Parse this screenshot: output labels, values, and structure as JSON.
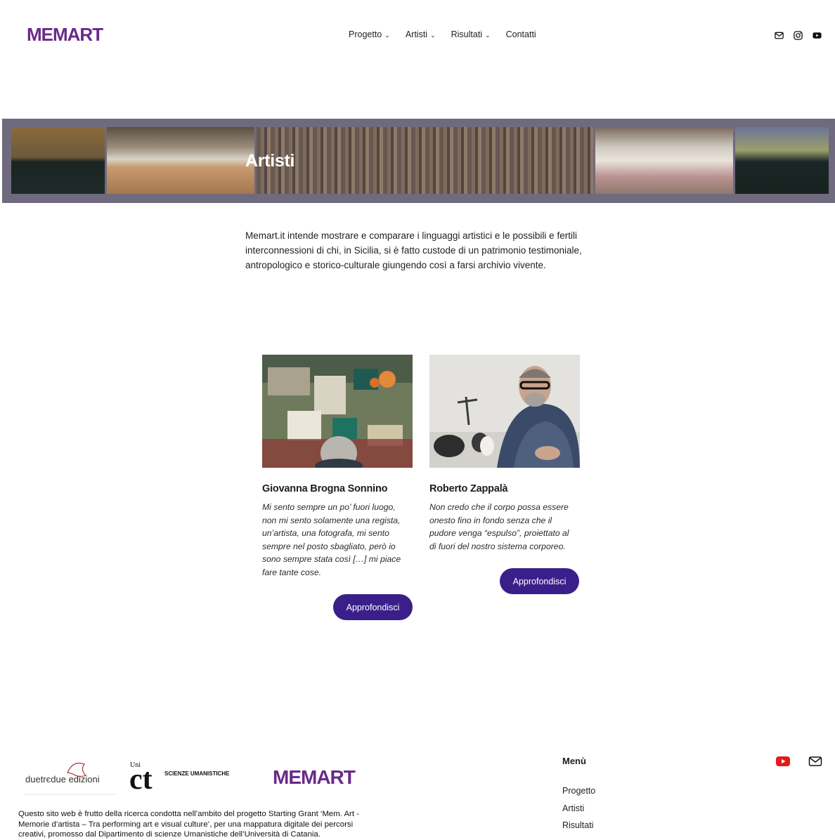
{
  "header": {
    "logo_text": "MEMART",
    "nav": [
      {
        "label": "Progetto",
        "has_dropdown": true
      },
      {
        "label": "Artisti",
        "has_dropdown": true
      },
      {
        "label": "Risultati",
        "has_dropdown": true
      },
      {
        "label": "Contatti",
        "has_dropdown": false
      }
    ],
    "social_icons": [
      "mail-icon",
      "instagram-icon",
      "youtube-icon"
    ]
  },
  "hero": {
    "title": "Artisti"
  },
  "intro": "Memart.it intende mostrare e comparare i linguaggi artistici e le possibili e fertili interconnessioni di chi, in Sicilia, si è fatto custode di un patrimonio testimoniale, antropologico e storico-culturale giungendo così a farsi archivio vivente.",
  "artists": [
    {
      "name": "Giovanna Brogna Sonnino",
      "quote": "Mi sento sempre un po’ fuori luogo, non mi sento solamente una regista, un’artista, una fotografa, mi sento sempre nel posto sbagliato, però io sono sempre stata così […] mi piace fare tante cose.",
      "button": "Approfondisci"
    },
    {
      "name": "Roberto Zappalà",
      "quote": "Non credo che il corpo possa essere onesto fino in fondo senza che il pudore venga “espulso”, proiettato al di fuori del nostro sistema corporeo.",
      "button": "Approfondisci"
    }
  ],
  "footer": {
    "duetredue_logo_text": "duetrєdue edizioni",
    "unict_logo": {
      "small": "Uni",
      "big": "ct",
      "caption": "SCIENZE UMANISTICHE"
    },
    "logo_text": "MEMART",
    "description": "Questo sito web è frutto della ricerca condotta nell’ambito del progetto Starting Grant ‘Mem. Art - Memorie d’artista – Tra performing art e visual culture’, per una mappatura digitale dei percorsi creativi, promosso dal Dipartimento di scienze Umanistiche dell’Università di Catania.",
    "menu_title": "Menù",
    "menu_items": [
      "Progetto",
      "Artisti",
      "Risultati"
    ],
    "icons": [
      "youtube-icon",
      "mail-icon"
    ]
  },
  "colors": {
    "accent": "#3a1f8a",
    "logo_purple": "#6a2a8a",
    "youtube_red": "#e21b1b"
  }
}
